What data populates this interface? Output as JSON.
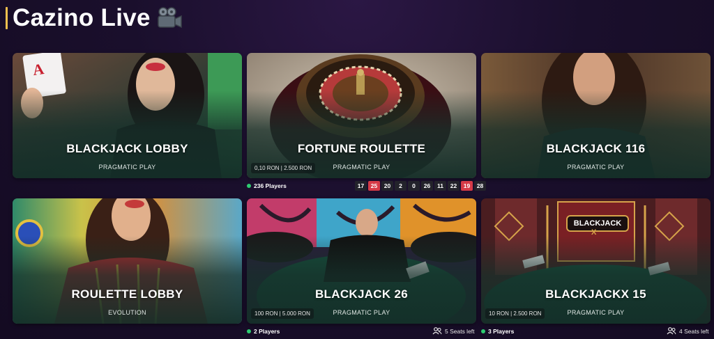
{
  "header": {
    "title": "Cazino Live",
    "icon": "movie-camera-icon"
  },
  "cards": [
    {
      "name": "BLACKJACK LOBBY",
      "provider": "PRAGMATIC PLAY"
    },
    {
      "name": "FORTUNE ROULETTE",
      "provider": "PRAGMATIC PLAY",
      "limits": "0,10 RON | 2.500 RON",
      "players": "236 Players",
      "results": [
        {
          "value": "17",
          "color": "#23232b"
        },
        {
          "value": "25",
          "color": "#d63a47"
        },
        {
          "value": "20",
          "color": "#23232b"
        },
        {
          "value": "2",
          "color": "#23232b"
        },
        {
          "value": "0",
          "color": "#23232b"
        },
        {
          "value": "26",
          "color": "#23232b"
        },
        {
          "value": "11",
          "color": "#23232b"
        },
        {
          "value": "22",
          "color": "#23232b"
        },
        {
          "value": "19",
          "color": "#d63a47"
        },
        {
          "value": "28",
          "color": "#23232b"
        }
      ]
    },
    {
      "name": "BLACKJACK 116",
      "provider": "PRAGMATIC PLAY"
    },
    {
      "name": "ROULETTE LOBBY",
      "provider": "EVOLUTION"
    },
    {
      "name": "BLACKJACK 26",
      "provider": "PRAGMATIC PLAY",
      "limits": "100 RON | 5.000 RON",
      "players": "2 Players",
      "seats": "5 Seats left"
    },
    {
      "name": "BLACKJACKX 15",
      "provider": "PRAGMATIC PLAY",
      "limits": "10 RON | 2.500 RON",
      "players": "3 Players",
      "seats": "4 Seats left",
      "table_logo": "BLACKJACK",
      "table_logo_sub": "X"
    }
  ],
  "colors": {
    "accent": "#f2c14e",
    "online": "#2ecc71",
    "red_number": "#d63a47",
    "black_number": "#23232b"
  }
}
